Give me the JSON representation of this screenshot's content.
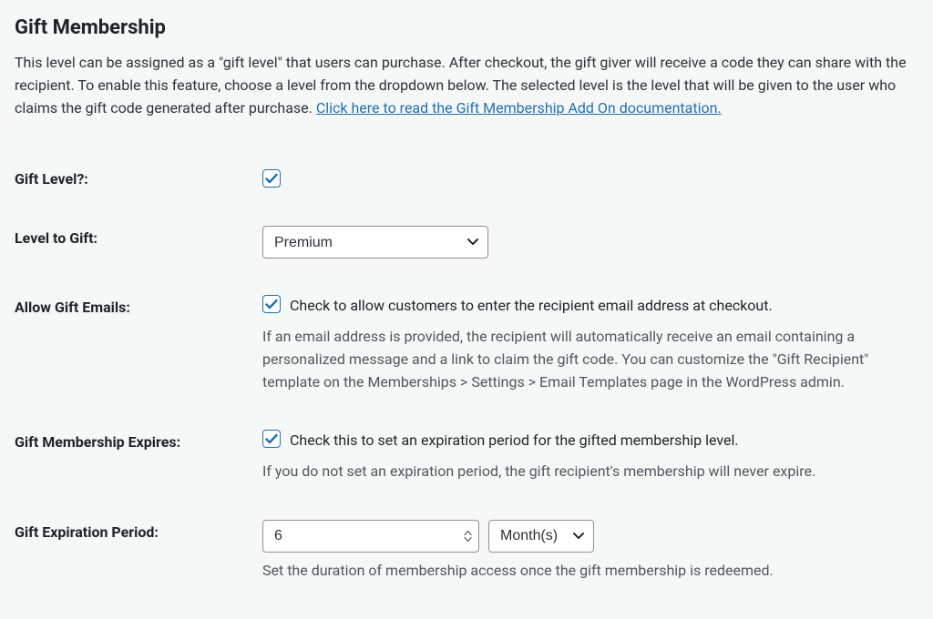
{
  "section": {
    "title": "Gift Membership",
    "description_before_link": "This level can be assigned as a \"gift level\" that users can purchase. After checkout, the gift giver will receive a code they can share with the recipient. To enable this feature, choose a level from the dropdown below. The selected level is the level that will be given to the user who claims the gift code generated after purchase. ",
    "doc_link_text": "Click here to read the Gift Membership Add On documentation."
  },
  "fields": {
    "gift_level": {
      "label": "Gift Level?:",
      "checked": true
    },
    "level_to_gift": {
      "label": "Level to Gift:",
      "selected": "Premium"
    },
    "allow_gift_emails": {
      "label": "Allow Gift Emails:",
      "checked": true,
      "checkbox_text": "Check to allow customers to enter the recipient email address at checkout.",
      "help": "If an email address is provided, the recipient will automatically receive an email containing a personalized message and a link to claim the gift code. You can customize the \"Gift Recipient\" template on the Memberships > Settings > Email Templates page in the WordPress admin."
    },
    "gift_expires": {
      "label": "Gift Membership Expires:",
      "checked": true,
      "checkbox_text": "Check this to set an expiration period for the gifted membership level.",
      "help": "If you do not set an expiration period, the gift recipient's membership will never expire."
    },
    "expiration_period": {
      "label": "Gift Expiration Period:",
      "value": "6",
      "unit": "Month(s)",
      "help": "Set the duration of membership access once the gift membership is redeemed."
    }
  }
}
